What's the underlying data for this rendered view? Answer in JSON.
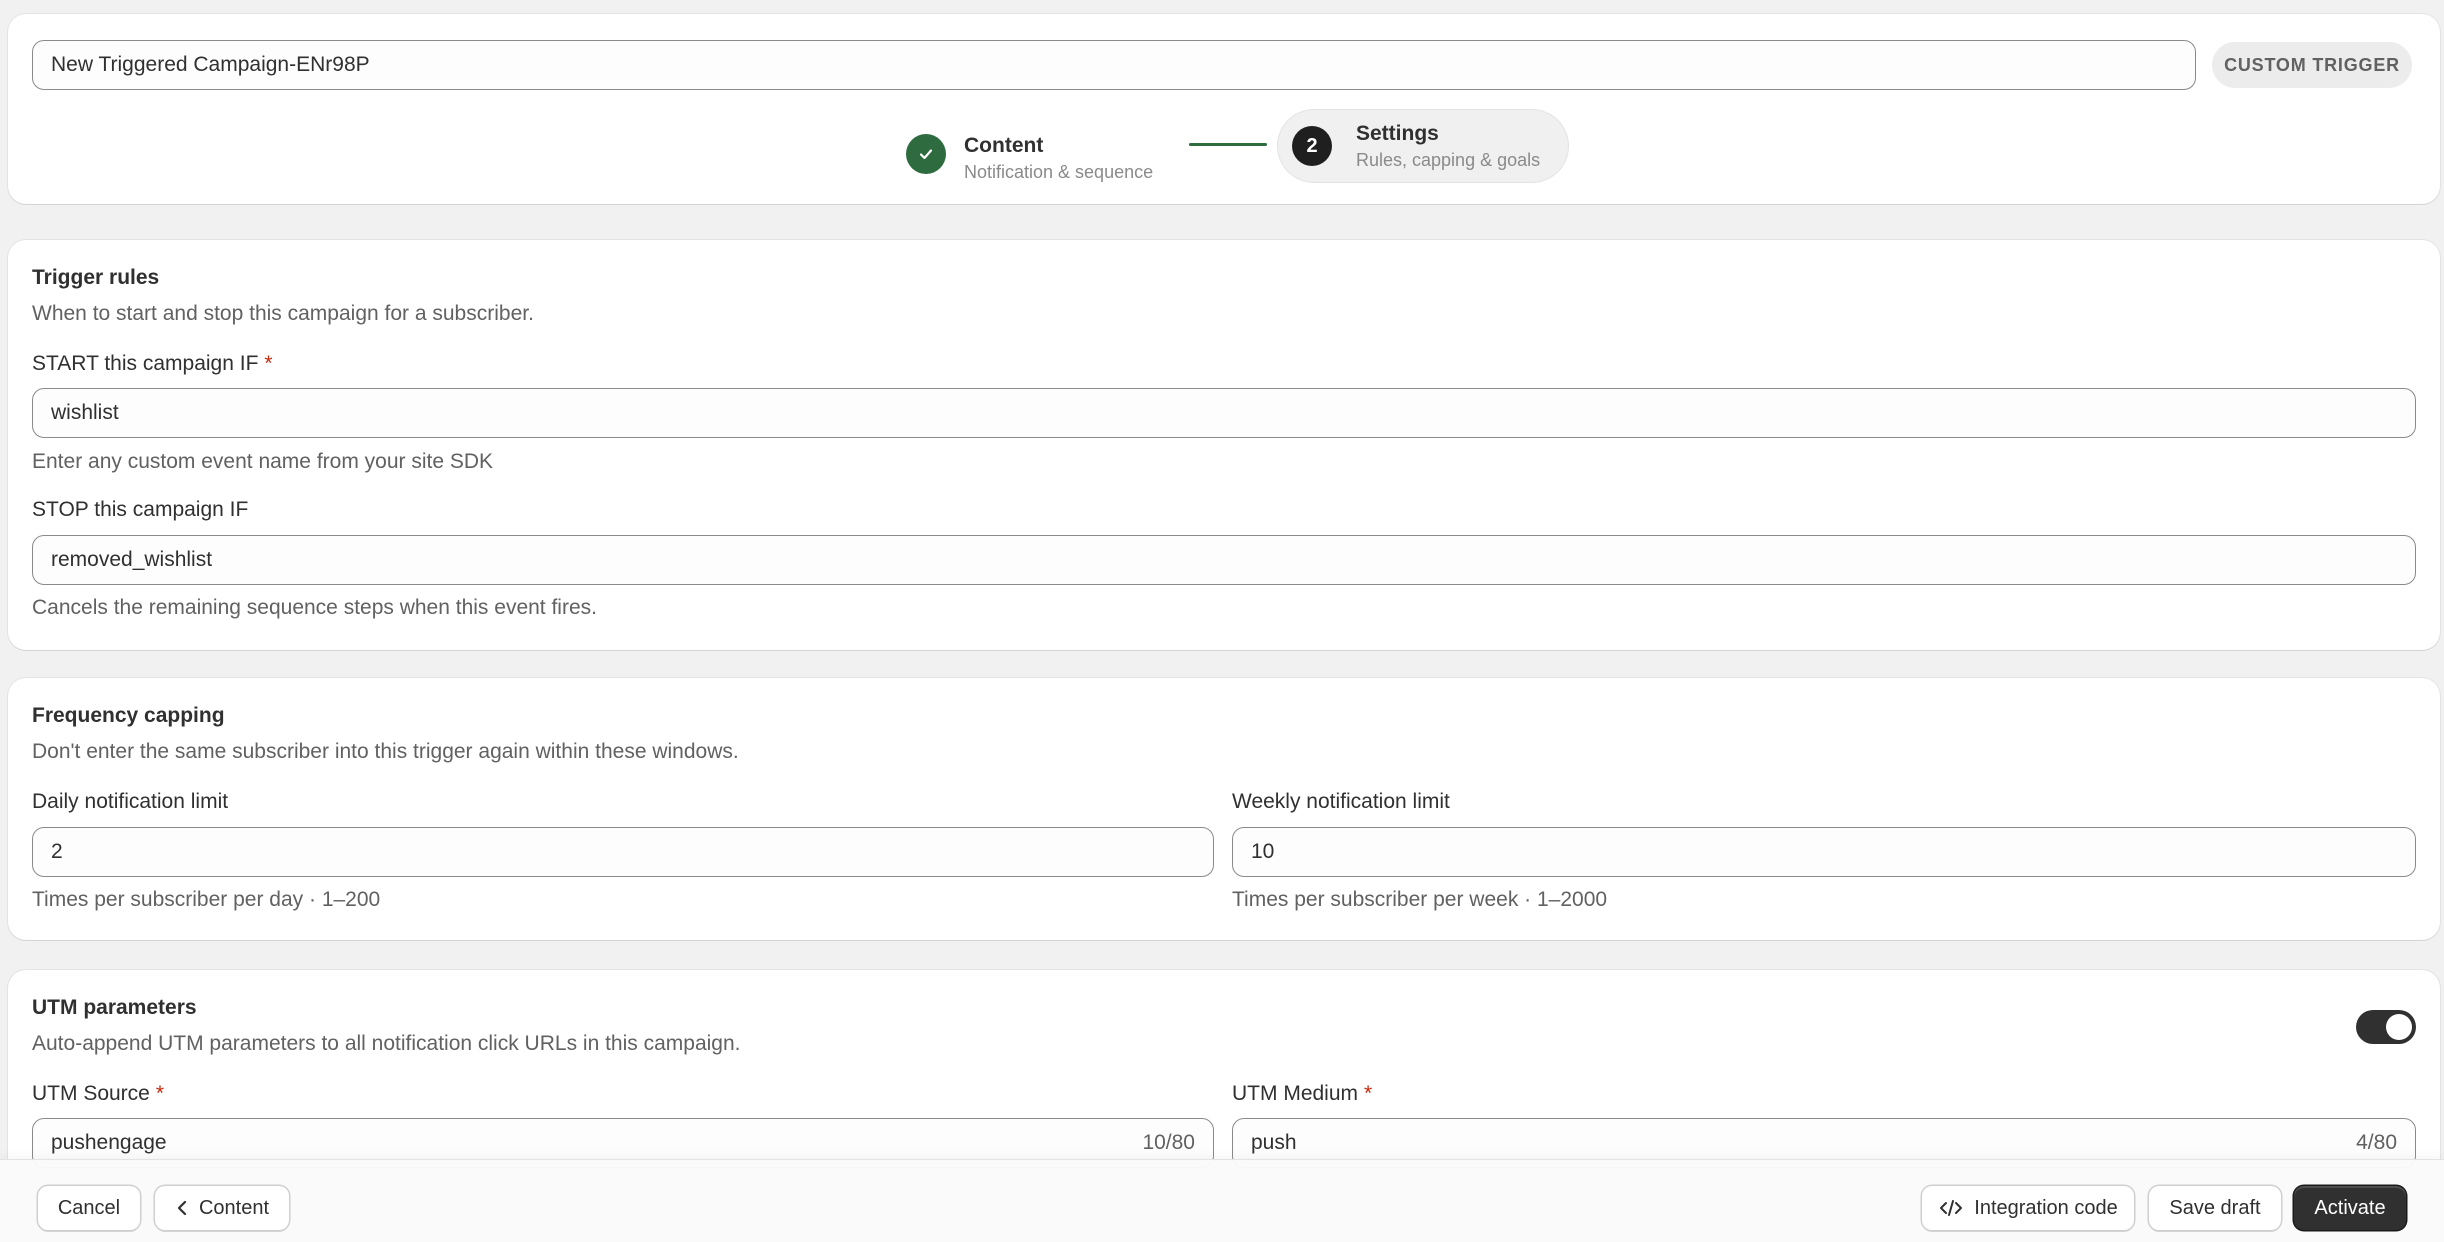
{
  "header": {
    "campaign_name": "New Triggered Campaign-ENr98P",
    "badge": "CUSTOM TRIGGER",
    "steps": [
      {
        "title": "Content",
        "subtitle": "Notification & sequence",
        "status": "complete"
      },
      {
        "number": "2",
        "title": "Settings",
        "subtitle": "Rules, capping & goals",
        "status": "active"
      }
    ]
  },
  "trigger_rules": {
    "title": "Trigger rules",
    "subtitle": "When to start and stop this campaign for a subscriber.",
    "start_label": "START this campaign IF",
    "start_required": "*",
    "start_value": "wishlist",
    "start_hint": "Enter any custom event name from your site SDK",
    "stop_label": "STOP this campaign IF",
    "stop_value": "removed_wishlist",
    "stop_hint": "Cancels the remaining sequence steps when this event fires."
  },
  "frequency_capping": {
    "title": "Frequency capping",
    "subtitle": "Don't enter the same subscriber into this trigger again within these windows.",
    "daily_label": "Daily notification limit",
    "daily_value": "2",
    "daily_hint": "Times per subscriber per day · 1–200",
    "weekly_label": "Weekly notification limit",
    "weekly_value": "10",
    "weekly_hint": "Times per subscriber per week · 1–2000"
  },
  "utm": {
    "title": "UTM parameters",
    "subtitle": "Auto-append UTM parameters to all notification click URLs in this campaign.",
    "enabled": true,
    "source_label": "UTM Source",
    "source_required": "*",
    "source_value": "pushengage",
    "source_counter": "10/80",
    "medium_label": "UTM Medium",
    "medium_required": "*",
    "medium_value": "push",
    "medium_counter": "4/80"
  },
  "footer": {
    "cancel": "Cancel",
    "back": "Content",
    "integration": "Integration code",
    "save_draft": "Save draft",
    "activate": "Activate"
  },
  "colors": {
    "accent_green": "#2e6b3f",
    "primary_dark": "#303030",
    "required_red": "#c5280c"
  },
  "icons": {
    "step_complete": "check-icon",
    "back": "chevron-left-icon",
    "integration": "code-icon"
  }
}
